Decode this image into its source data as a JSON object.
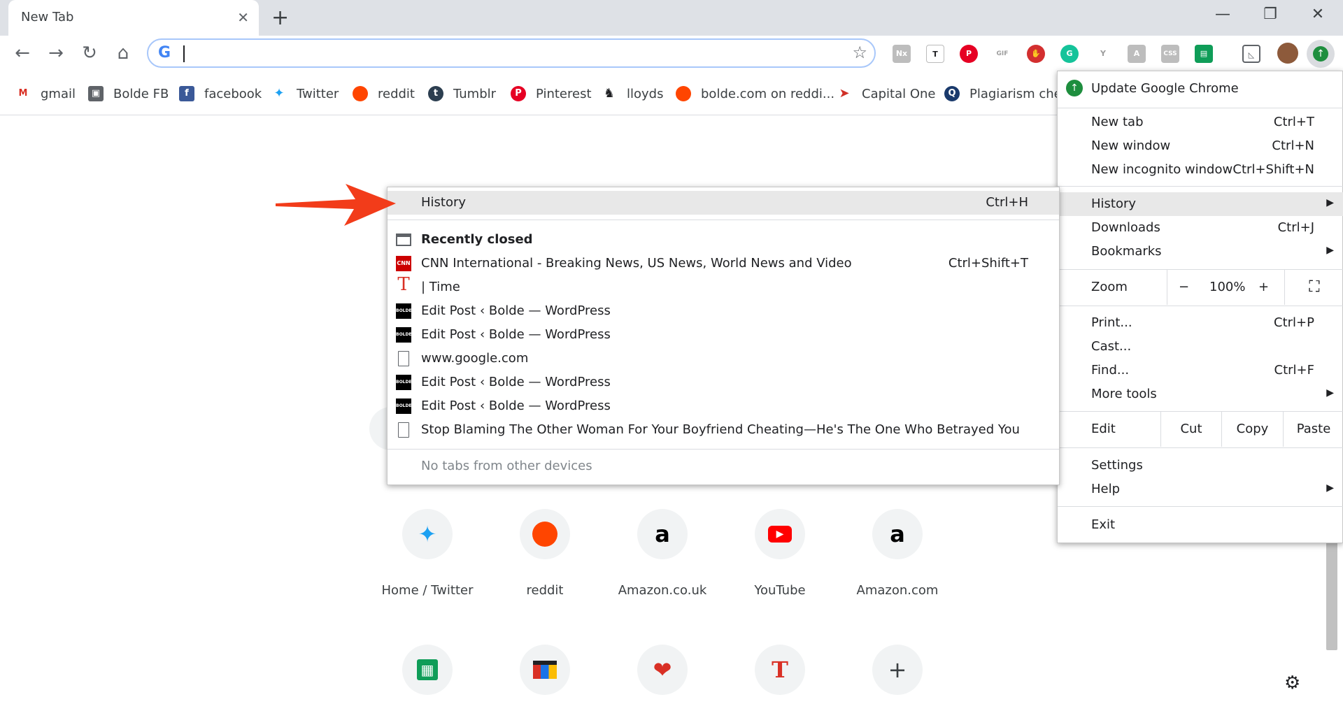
{
  "tab": {
    "title": "New Tab",
    "close": "✕"
  },
  "window": {
    "new_tab": "+",
    "minimize": "—",
    "restore": "❐",
    "close": "✕"
  },
  "toolbar": {
    "back": "←",
    "forward": "→",
    "reload": "↻",
    "home": "⌂",
    "star": "☆",
    "google_logo": "G"
  },
  "omnibox": {
    "value": "",
    "placeholder": ""
  },
  "bookmarks": [
    {
      "label": "gmail",
      "icon": "gmail-icon",
      "color": "#d93025",
      "glyph": "M"
    },
    {
      "label": "Bolde FB",
      "icon": "bolde-fb-icon",
      "color": "#5f6368",
      "glyph": "▣"
    },
    {
      "label": "facebook",
      "icon": "facebook-icon",
      "color": "#3b5998",
      "glyph": "f"
    },
    {
      "label": "Twitter",
      "icon": "twitter-icon",
      "color": "#1da1f2",
      "glyph": "🐦"
    },
    {
      "label": "reddit",
      "icon": "reddit-icon",
      "color": "#ff4500",
      "glyph": "●"
    },
    {
      "label": "Tumblr",
      "icon": "tumblr-icon",
      "color": "#2c3e50",
      "glyph": "t"
    },
    {
      "label": "Pinterest",
      "icon": "pinterest-icon",
      "color": "#e60023",
      "glyph": "P"
    },
    {
      "label": "lloyds",
      "icon": "lloyds-icon",
      "color": "#ffffff",
      "glyph": "🐎"
    },
    {
      "label": "bolde.com on reddi...",
      "icon": "reddit-icon",
      "color": "#ff4500",
      "glyph": "●"
    },
    {
      "label": "Capital One",
      "icon": "capital-one-icon",
      "color": "#ffffff",
      "glyph": "➤"
    },
    {
      "label": "Plagiarism chec",
      "icon": "plagiarism-icon",
      "color": "#1a3a6c",
      "glyph": "Q"
    }
  ],
  "tiles_row1": [
    {
      "label": "Home / Twitter",
      "icon": "twitter-icon",
      "glyph": "🐦",
      "color": "#1da1f2"
    },
    {
      "label": "reddit",
      "icon": "reddit-icon",
      "glyph": "●",
      "color": "#ff4500"
    },
    {
      "label": "Amazon.co.uk",
      "icon": "amazon-icon",
      "glyph": "a",
      "color": "#000000"
    },
    {
      "label": "YouTube",
      "icon": "youtube-icon",
      "glyph": "▶",
      "color": "#ff0000"
    },
    {
      "label": "Amazon.com",
      "icon": "amazon-icon",
      "glyph": "a",
      "color": "#000000"
    }
  ],
  "tiles_row2": [
    {
      "icon": "sheets-icon",
      "glyph": "▦",
      "color": "#0f9d58"
    },
    {
      "icon": "shopping-bag-icon",
      "glyph": "▤",
      "color": "#e37400"
    },
    {
      "icon": "heart-icon",
      "glyph": "❤",
      "color": "#d93025"
    },
    {
      "icon": "time-t-icon",
      "glyph": "T",
      "color": "#d93025"
    },
    {
      "icon": "add-shortcut-icon",
      "glyph": "+",
      "color": "#3c4043"
    }
  ],
  "chrome_menu": {
    "update": "Update Google Chrome",
    "new_tab": {
      "label": "New tab",
      "shortcut": "Ctrl+T"
    },
    "new_window": {
      "label": "New window",
      "shortcut": "Ctrl+N"
    },
    "new_incognito": {
      "label": "New incognito window",
      "shortcut": "Ctrl+Shift+N"
    },
    "history": {
      "label": "History"
    },
    "downloads": {
      "label": "Downloads",
      "shortcut": "Ctrl+J"
    },
    "bookmarks": {
      "label": "Bookmarks"
    },
    "zoom": {
      "label": "Zoom",
      "minus": "−",
      "value": "100%",
      "plus": "+",
      "fullscreen": "⛶"
    },
    "print": {
      "label": "Print...",
      "shortcut": "Ctrl+P"
    },
    "cast": {
      "label": "Cast..."
    },
    "find": {
      "label": "Find...",
      "shortcut": "Ctrl+F"
    },
    "more_tools": {
      "label": "More tools"
    },
    "edit": {
      "label": "Edit",
      "cut": "Cut",
      "copy": "Copy",
      "paste": "Paste"
    },
    "settings": {
      "label": "Settings"
    },
    "help": {
      "label": "Help"
    },
    "exit": {
      "label": "Exit"
    },
    "arrow": "▶"
  },
  "history_menu": {
    "history": {
      "label": "History",
      "shortcut": "Ctrl+H"
    },
    "recently_closed": "Recently closed",
    "items": [
      {
        "label": "CNN International - Breaking News, US News, World News and Video",
        "shortcut": "Ctrl+Shift+T",
        "icon": "cnn-icon",
        "glyph": "CNN",
        "color": "#cc0000"
      },
      {
        "label": "| Time",
        "shortcut": "",
        "icon": "time-icon",
        "glyph": "T",
        "color": "#ffffff"
      },
      {
        "label": "Edit Post ‹ Bolde — WordPress",
        "shortcut": "",
        "icon": "bolde-icon",
        "glyph": "BOLDE",
        "color": "#000000"
      },
      {
        "label": "Edit Post ‹ Bolde — WordPress",
        "shortcut": "",
        "icon": "bolde-icon",
        "glyph": "BOLDE",
        "color": "#000000"
      },
      {
        "label": "www.google.com",
        "shortcut": "",
        "icon": "page-icon",
        "glyph": "🗋",
        "color": "#ffffff"
      },
      {
        "label": "Edit Post ‹ Bolde — WordPress",
        "shortcut": "",
        "icon": "bolde-icon",
        "glyph": "BOLDE",
        "color": "#000000"
      },
      {
        "label": "Edit Post ‹ Bolde — WordPress",
        "shortcut": "",
        "icon": "bolde-icon",
        "glyph": "BOLDE",
        "color": "#000000"
      },
      {
        "label": "Stop Blaming The Other Woman For Your Boyfriend Cheating—He's The One Who Betrayed You",
        "shortcut": "",
        "icon": "page-icon",
        "glyph": "🗋",
        "color": "#ffffff"
      }
    ],
    "no_tabs": "No tabs from other devices"
  },
  "colors": {
    "accent": "#1a73e8",
    "arrow": "#f23c1a",
    "menu_highlight": "#e8e8e8"
  }
}
